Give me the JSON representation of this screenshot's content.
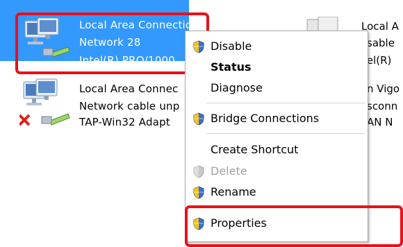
{
  "connections": [
    {
      "name": "Local Area Connection",
      "status": "Network  28",
      "adapter": "Intel(R) PRO/1000",
      "selected": true
    },
    {
      "name": "Local Area Connec",
      "status": "Network cable unp",
      "adapter": "TAP-Win32 Adapt",
      "selected": false,
      "disconnected": true
    }
  ],
  "right_column": {
    "row1": [
      "Local A",
      "sable",
      "tel(R)"
    ],
    "row2": [
      "n Vigo",
      "sconn",
      "AN N"
    ]
  },
  "context_menu": {
    "items": [
      {
        "label": "Disable",
        "shield": true,
        "bold": false,
        "disabled": false
      },
      {
        "label": "Status",
        "shield": false,
        "bold": true,
        "disabled": false
      },
      {
        "label": "Diagnose",
        "shield": false,
        "bold": false,
        "disabled": false
      },
      {
        "label": "Bridge Connections",
        "shield": true,
        "bold": false,
        "disabled": false
      },
      {
        "label": "Create Shortcut",
        "shield": false,
        "bold": false,
        "disabled": false
      },
      {
        "label": "Delete",
        "shield": true,
        "bold": false,
        "disabled": true
      },
      {
        "label": "Rename",
        "shield": true,
        "bold": false,
        "disabled": false
      },
      {
        "label": "Properties",
        "shield": true,
        "bold": false,
        "disabled": false
      }
    ]
  },
  "colors": {
    "selection": "#3399ff",
    "highlight_box": "#e8101b",
    "menu_border": "#a8a8a8",
    "disabled_text": "#a0a0a0"
  },
  "icons": [
    "network-adapter-icon",
    "network-disconnected-icon",
    "uac-shield-icon"
  ]
}
